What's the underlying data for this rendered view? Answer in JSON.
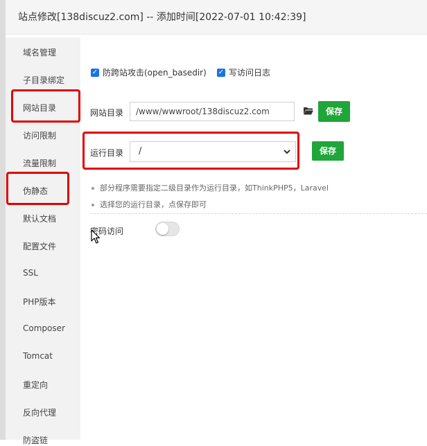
{
  "title": "站点修改[138discuz2.com] -- 添加时间[2022-07-01 10:42:39]",
  "sidebar": {
    "items": [
      {
        "label": "域名管理"
      },
      {
        "label": "子目录绑定"
      },
      {
        "label": "网站目录"
      },
      {
        "label": "访问限制"
      },
      {
        "label": "流量限制"
      },
      {
        "label": "伪静态"
      },
      {
        "label": "默认文档"
      },
      {
        "label": "配置文件"
      },
      {
        "label": "SSL"
      },
      {
        "label": "PHP版本"
      },
      {
        "label": "Composer"
      },
      {
        "label": "Tomcat"
      },
      {
        "label": "重定向"
      },
      {
        "label": "反向代理"
      },
      {
        "label": "防盗链"
      }
    ]
  },
  "main": {
    "anti_cross_site_label": "防跨站攻击(open_basedir)",
    "anti_cross_site_checked": true,
    "access_log_label": "写访问日志",
    "access_log_checked": true,
    "site_dir_label": "网站目录",
    "site_dir_value": "/www/wwwroot/138discuz2.com",
    "save_label": "保存",
    "run_dir_label": "运行目录",
    "run_dir_selected": "/",
    "tips": [
      "部分程序需要指定二级目录作为运行目录，如ThinkPHP5，Laravel",
      "选择您的运行目录，点保存即可"
    ],
    "password_access_label": "密码访问",
    "password_access_enabled": false
  },
  "colors": {
    "accent_green": "#20a53a",
    "checkbox_blue": "#1a73e8",
    "highlight_red": "#e00000"
  },
  "icons": [
    "checkbox-checked-icon",
    "folder-open-icon",
    "chevron-down-icon",
    "mouse-cursor-icon"
  ]
}
